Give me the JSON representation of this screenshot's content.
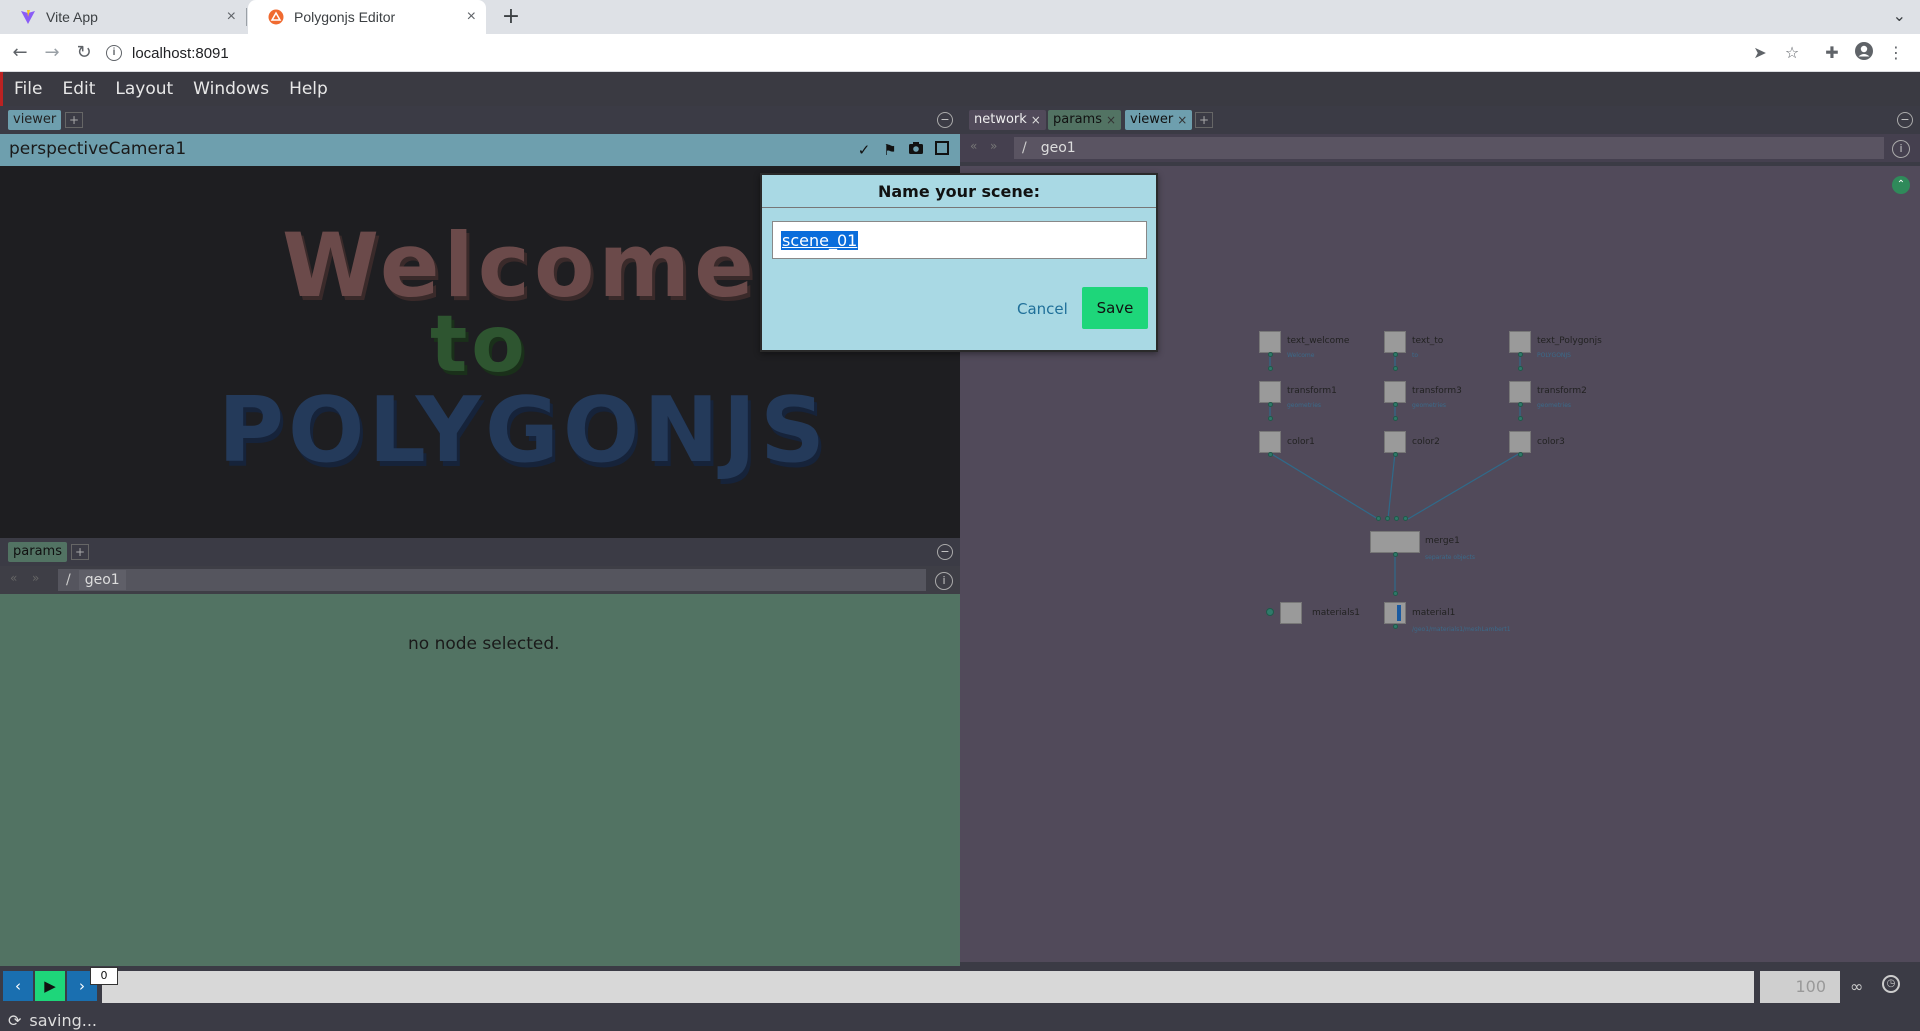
{
  "browser": {
    "tabs": [
      {
        "title": "Vite App",
        "close": "×"
      },
      {
        "title": "Polygonjs Editor",
        "close": "×"
      }
    ],
    "new_tab": "+",
    "url": "localhost:8091",
    "back": "←",
    "forward": "→",
    "reload": "↻",
    "tab_menu": "⌄"
  },
  "menu": [
    "File",
    "Edit",
    "Layout",
    "Windows",
    "Help"
  ],
  "viewer_panel": {
    "tab": "viewer",
    "add": "+",
    "camera": "perspectiveCamera1",
    "scene_text": [
      "Welcome",
      "to",
      "POLYGONJS"
    ]
  },
  "params_panel": {
    "tab": "params",
    "add": "+",
    "path_root": "/",
    "path_node": "geo1",
    "message": "no node selected."
  },
  "network_panel": {
    "tabs": [
      {
        "label": "network",
        "close": "×"
      },
      {
        "label": "params",
        "close": "×"
      },
      {
        "label": "viewer",
        "close": "×"
      }
    ],
    "add": "+",
    "path_root": "/",
    "path_node": "geo1",
    "nodes": [
      {
        "name": "text_welcome",
        "sub": "Welcome"
      },
      {
        "name": "text_to",
        "sub": "to"
      },
      {
        "name": "text_Polygonjs",
        "sub": "POLYGONJS"
      },
      {
        "name": "transform1",
        "sub": "geometries"
      },
      {
        "name": "transform3",
        "sub": "geometries"
      },
      {
        "name": "transform2",
        "sub": "geometries"
      },
      {
        "name": "color1",
        "sub": ""
      },
      {
        "name": "color2",
        "sub": ""
      },
      {
        "name": "color3",
        "sub": ""
      },
      {
        "name": "merge1",
        "sub": "separate objects"
      },
      {
        "name": "materials1",
        "sub": ""
      },
      {
        "name": "material1",
        "sub": "/geo1/materials1/meshLambert1"
      }
    ]
  },
  "timeline": {
    "current_frame": "0",
    "end_frame": "100"
  },
  "status": {
    "text": "saving..."
  },
  "dialog": {
    "title": "Name your scene:",
    "value": "scene_01",
    "cancel": "Cancel",
    "save": "Save"
  },
  "colors": {
    "viewer_header": "#6e9fae",
    "params_bg": "#527363",
    "network_bg": "#514a5a",
    "dialog_bg": "#a9d9e4",
    "save_button": "#1ed67a",
    "play_button": "#1ed67a",
    "step_button": "#1a6fb0"
  }
}
